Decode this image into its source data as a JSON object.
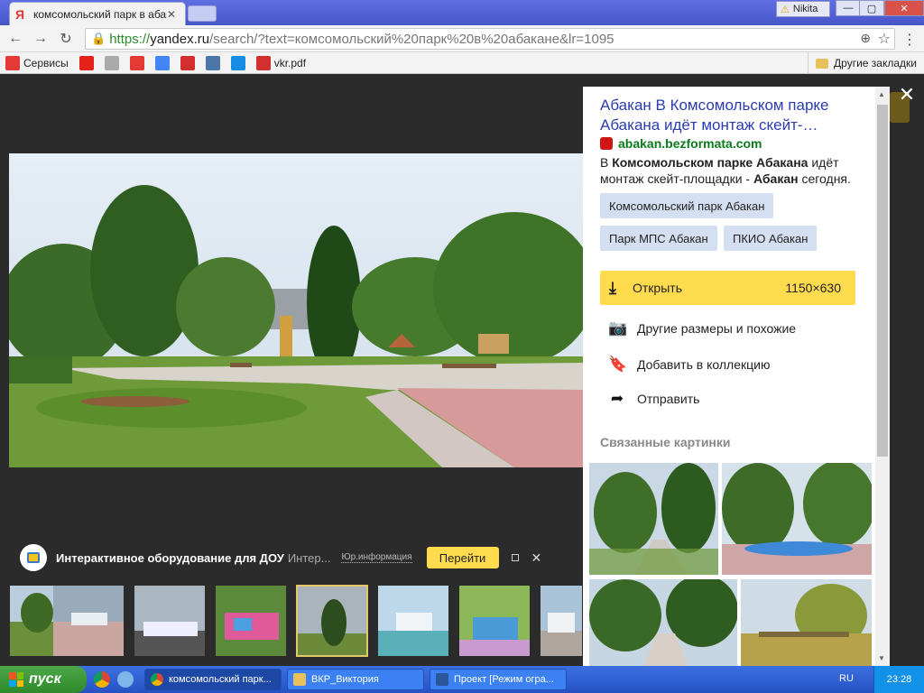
{
  "window": {
    "tab_title": "комсомольский парк в абака...",
    "tab_favicon": "Я",
    "user_name": "Nikita",
    "minimize_label": "—",
    "maximize_label": "▢",
    "close_label": "✕"
  },
  "omnibox": {
    "scheme": "https://",
    "host": "yandex.ru",
    "path": "/search/?text=комсомольский%20парк%20в%20абакане&lr=1095"
  },
  "bookmarks": {
    "items": [
      {
        "label": "Сервисы",
        "icon": "apps-grid-icon",
        "color": "#e53935"
      },
      {
        "label": "",
        "icon": "youtube-icon",
        "color": "#e62117"
      },
      {
        "label": "",
        "icon": "page-icon",
        "color": "#aaaaaa"
      },
      {
        "label": "",
        "icon": "yandex-icon",
        "color": "#e53935"
      },
      {
        "label": "",
        "icon": "google-icon",
        "color": "#4285f4"
      },
      {
        "label": "",
        "icon": "alfa-icon",
        "color": "#d32f2f"
      },
      {
        "label": "",
        "icon": "vk-icon",
        "color": "#4a76a8"
      },
      {
        "label": "",
        "icon": "mail-icon",
        "color": "#168de2"
      },
      {
        "label": "vkr.pdf",
        "icon": "pdf-icon",
        "color": "#d32f2f"
      }
    ],
    "other_label": "Другие закладки"
  },
  "ad": {
    "title": "Интерактивное оборудование для ДОУ",
    "subtitle": "Интер...",
    "legal": "Юр.информация",
    "go_label": "Перейти"
  },
  "panel": {
    "result_title": "Абакан В Комсомольском парке Абакана идёт монтаж скейт-…",
    "source": "abakan.bezformata.com",
    "snippet_parts": {
      "p1": "В ",
      "b1": "Комсомольском парке Абакана",
      "p2": " идёт монтаж скейт-площадки - ",
      "b2": "Абакан",
      "p3": " сегодня."
    },
    "tags": [
      "Комсомольский парк Абакан",
      "Парк МПС Абакан",
      "ПКИО Абакан"
    ],
    "open_label": "Открыть",
    "open_size": "1150×630",
    "actions": [
      "Другие размеры и похожие",
      "Добавить в коллекцию",
      "Отправить"
    ],
    "related_heading": "Связанные картинки"
  },
  "taskbar": {
    "start_label": "пуск",
    "tasks": [
      "комсомольский парк...",
      "ВКР_Виктория",
      "Проект [Режим огра..."
    ],
    "lang": "RU",
    "clock": "23:28"
  },
  "colors": {
    "yandex_yellow": "#ffdb4d",
    "link_blue": "#2a3db0",
    "source_green": "#0b7a1b"
  }
}
